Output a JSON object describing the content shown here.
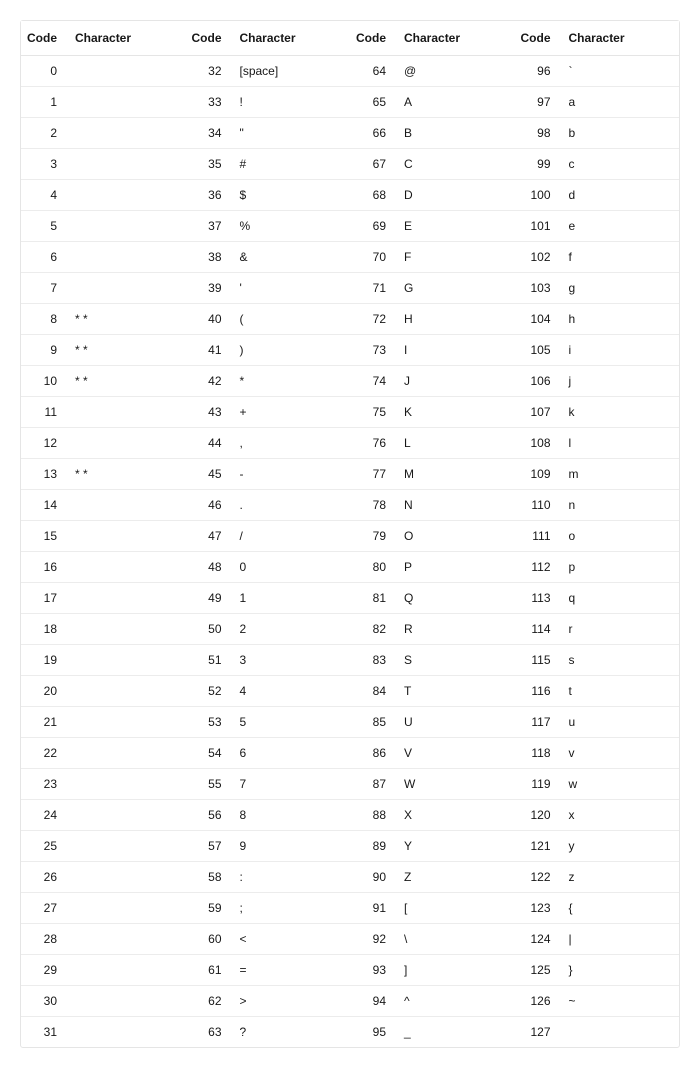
{
  "headers": {
    "code": "Code",
    "character": "Character"
  },
  "columns": [
    [
      {
        "code": 0,
        "char": ""
      },
      {
        "code": 1,
        "char": ""
      },
      {
        "code": 2,
        "char": ""
      },
      {
        "code": 3,
        "char": ""
      },
      {
        "code": 4,
        "char": ""
      },
      {
        "code": 5,
        "char": ""
      },
      {
        "code": 6,
        "char": ""
      },
      {
        "code": 7,
        "char": ""
      },
      {
        "code": 8,
        "char": "* *"
      },
      {
        "code": 9,
        "char": "* *"
      },
      {
        "code": 10,
        "char": "* *"
      },
      {
        "code": 11,
        "char": ""
      },
      {
        "code": 12,
        "char": ""
      },
      {
        "code": 13,
        "char": "* *"
      },
      {
        "code": 14,
        "char": ""
      },
      {
        "code": 15,
        "char": ""
      },
      {
        "code": 16,
        "char": ""
      },
      {
        "code": 17,
        "char": ""
      },
      {
        "code": 18,
        "char": ""
      },
      {
        "code": 19,
        "char": ""
      },
      {
        "code": 20,
        "char": ""
      },
      {
        "code": 21,
        "char": ""
      },
      {
        "code": 22,
        "char": ""
      },
      {
        "code": 23,
        "char": ""
      },
      {
        "code": 24,
        "char": ""
      },
      {
        "code": 25,
        "char": ""
      },
      {
        "code": 26,
        "char": ""
      },
      {
        "code": 27,
        "char": ""
      },
      {
        "code": 28,
        "char": ""
      },
      {
        "code": 29,
        "char": ""
      },
      {
        "code": 30,
        "char": ""
      },
      {
        "code": 31,
        "char": ""
      }
    ],
    [
      {
        "code": 32,
        "char": "[space]"
      },
      {
        "code": 33,
        "char": "!"
      },
      {
        "code": 34,
        "char": "\""
      },
      {
        "code": 35,
        "char": "#"
      },
      {
        "code": 36,
        "char": "$"
      },
      {
        "code": 37,
        "char": "%"
      },
      {
        "code": 38,
        "char": "&"
      },
      {
        "code": 39,
        "char": "'"
      },
      {
        "code": 40,
        "char": "("
      },
      {
        "code": 41,
        "char": ")"
      },
      {
        "code": 42,
        "char": "*"
      },
      {
        "code": 43,
        "char": "+"
      },
      {
        "code": 44,
        "char": ","
      },
      {
        "code": 45,
        "char": "-"
      },
      {
        "code": 46,
        "char": "."
      },
      {
        "code": 47,
        "char": "/"
      },
      {
        "code": 48,
        "char": "0"
      },
      {
        "code": 49,
        "char": "1"
      },
      {
        "code": 50,
        "char": "2"
      },
      {
        "code": 51,
        "char": "3"
      },
      {
        "code": 52,
        "char": "4"
      },
      {
        "code": 53,
        "char": "5"
      },
      {
        "code": 54,
        "char": "6"
      },
      {
        "code": 55,
        "char": "7"
      },
      {
        "code": 56,
        "char": "8"
      },
      {
        "code": 57,
        "char": "9"
      },
      {
        "code": 58,
        "char": ":"
      },
      {
        "code": 59,
        "char": ";"
      },
      {
        "code": 60,
        "char": "<"
      },
      {
        "code": 61,
        "char": "="
      },
      {
        "code": 62,
        "char": ">"
      },
      {
        "code": 63,
        "char": "?"
      }
    ],
    [
      {
        "code": 64,
        "char": "@"
      },
      {
        "code": 65,
        "char": "A"
      },
      {
        "code": 66,
        "char": "B"
      },
      {
        "code": 67,
        "char": "C"
      },
      {
        "code": 68,
        "char": "D"
      },
      {
        "code": 69,
        "char": "E"
      },
      {
        "code": 70,
        "char": "F"
      },
      {
        "code": 71,
        "char": "G"
      },
      {
        "code": 72,
        "char": "H"
      },
      {
        "code": 73,
        "char": "I"
      },
      {
        "code": 74,
        "char": "J"
      },
      {
        "code": 75,
        "char": "K"
      },
      {
        "code": 76,
        "char": "L"
      },
      {
        "code": 77,
        "char": "M"
      },
      {
        "code": 78,
        "char": "N"
      },
      {
        "code": 79,
        "char": "O"
      },
      {
        "code": 80,
        "char": "P"
      },
      {
        "code": 81,
        "char": "Q"
      },
      {
        "code": 82,
        "char": "R"
      },
      {
        "code": 83,
        "char": "S"
      },
      {
        "code": 84,
        "char": "T"
      },
      {
        "code": 85,
        "char": "U"
      },
      {
        "code": 86,
        "char": "V"
      },
      {
        "code": 87,
        "char": "W"
      },
      {
        "code": 88,
        "char": "X"
      },
      {
        "code": 89,
        "char": "Y"
      },
      {
        "code": 90,
        "char": "Z"
      },
      {
        "code": 91,
        "char": "["
      },
      {
        "code": 92,
        "char": "\\"
      },
      {
        "code": 93,
        "char": "]"
      },
      {
        "code": 94,
        "char": "^"
      },
      {
        "code": 95,
        "char": "_"
      }
    ],
    [
      {
        "code": 96,
        "char": "`"
      },
      {
        "code": 97,
        "char": "a"
      },
      {
        "code": 98,
        "char": "b"
      },
      {
        "code": 99,
        "char": "c"
      },
      {
        "code": 100,
        "char": "d"
      },
      {
        "code": 101,
        "char": "e"
      },
      {
        "code": 102,
        "char": "f"
      },
      {
        "code": 103,
        "char": "g"
      },
      {
        "code": 104,
        "char": "h"
      },
      {
        "code": 105,
        "char": "i"
      },
      {
        "code": 106,
        "char": "j"
      },
      {
        "code": 107,
        "char": "k"
      },
      {
        "code": 108,
        "char": "l"
      },
      {
        "code": 109,
        "char": "m"
      },
      {
        "code": 110,
        "char": "n"
      },
      {
        "code": 111,
        "char": "o"
      },
      {
        "code": 112,
        "char": "p"
      },
      {
        "code": 113,
        "char": "q"
      },
      {
        "code": 114,
        "char": "r"
      },
      {
        "code": 115,
        "char": "s"
      },
      {
        "code": 116,
        "char": "t"
      },
      {
        "code": 117,
        "char": "u"
      },
      {
        "code": 118,
        "char": "v"
      },
      {
        "code": 119,
        "char": "w"
      },
      {
        "code": 120,
        "char": "x"
      },
      {
        "code": 121,
        "char": "y"
      },
      {
        "code": 122,
        "char": "z"
      },
      {
        "code": 123,
        "char": "{"
      },
      {
        "code": 124,
        "char": "|"
      },
      {
        "code": 125,
        "char": "}"
      },
      {
        "code": 126,
        "char": "~"
      },
      {
        "code": 127,
        "char": ""
      }
    ]
  ]
}
